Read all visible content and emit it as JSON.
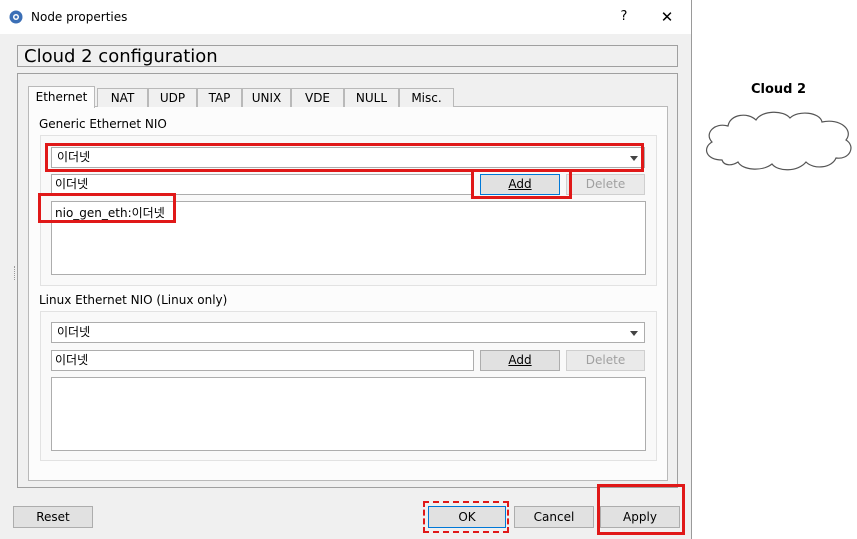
{
  "window": {
    "title": "Node properties",
    "help_label": "?",
    "close_label": "✕",
    "icon": "gns3-icon"
  },
  "config_title": "Cloud 2 configuration",
  "tabs": [
    {
      "label": "Ethernet",
      "active": true
    },
    {
      "label": "NAT"
    },
    {
      "label": "UDP"
    },
    {
      "label": "TAP"
    },
    {
      "label": "UNIX"
    },
    {
      "label": "VDE"
    },
    {
      "label": "NULL"
    },
    {
      "label": "Misc."
    }
  ],
  "generic": {
    "label": "Generic Ethernet NIO",
    "combo_value": "이더넷",
    "input_value": "이더넷",
    "add_label": "Add",
    "delete_label": "Delete",
    "list_items": [
      "nio_gen_eth:이더넷"
    ]
  },
  "linux": {
    "label": "Linux Ethernet NIO (Linux only)",
    "combo_value": "이더넷",
    "input_value": "이더넷",
    "add_label": "Add",
    "delete_label": "Delete"
  },
  "buttons": {
    "reset": "Reset",
    "ok": "OK",
    "cancel": "Cancel",
    "apply": "Apply"
  },
  "canvas": {
    "node_label": "Cloud 2",
    "node_icon": "cloud-icon"
  },
  "colors": {
    "highlight": "#e01818",
    "focus": "#0078d7"
  }
}
